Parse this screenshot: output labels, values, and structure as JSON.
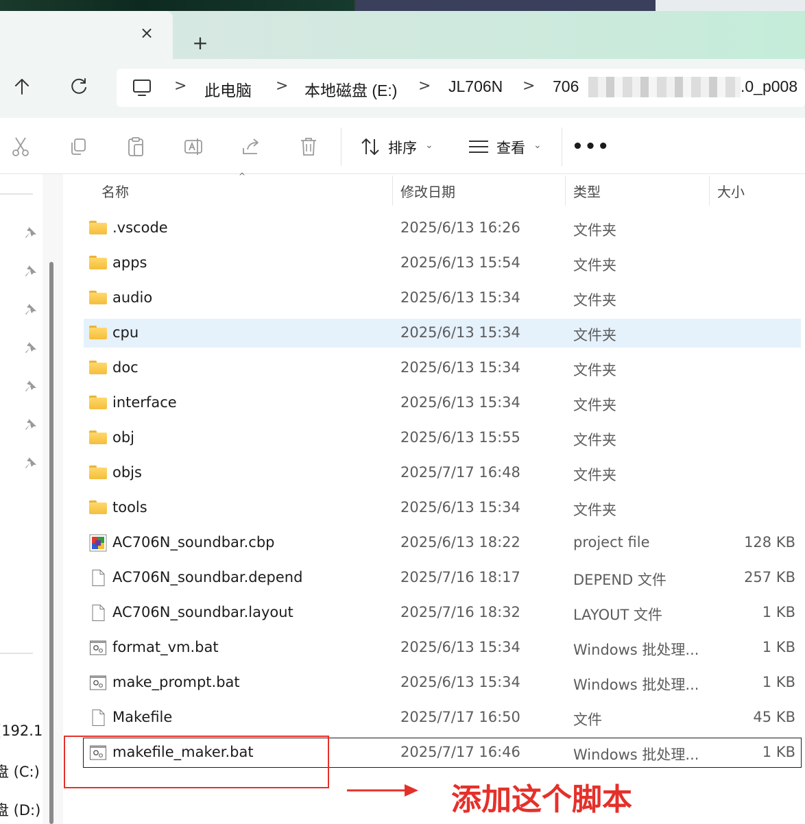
{
  "tabs": {
    "close_glyph": "×",
    "new_tab_glyph": "+"
  },
  "address": {
    "crumbs": [
      "此电脑",
      "本地磁盘 (E:)",
      "JL706N",
      "706 "
    ],
    "crumb_tail": ".0_p008",
    "separator": ">"
  },
  "toolbar": {
    "sort_label": "排序",
    "view_label": "查看",
    "more_label": "•••"
  },
  "nav": {
    "drives": [
      "(192.1",
      "盘 (C:)",
      "盘 (D:)"
    ]
  },
  "columns": {
    "name": "名称",
    "date": "修改日期",
    "type": "类型",
    "size": "大小"
  },
  "files": [
    {
      "name": ".vscode",
      "date": "2025/6/13 16:26",
      "type": "文件夹",
      "size": "",
      "kind": "folder"
    },
    {
      "name": "apps",
      "date": "2025/6/13 15:54",
      "type": "文件夹",
      "size": "",
      "kind": "folder"
    },
    {
      "name": "audio",
      "date": "2025/6/13 15:34",
      "type": "文件夹",
      "size": "",
      "kind": "folder"
    },
    {
      "name": "cpu",
      "date": "2025/6/13 15:34",
      "type": "文件夹",
      "size": "",
      "kind": "folder"
    },
    {
      "name": "doc",
      "date": "2025/6/13 15:34",
      "type": "文件夹",
      "size": "",
      "kind": "folder"
    },
    {
      "name": "interface",
      "date": "2025/6/13 15:34",
      "type": "文件夹",
      "size": "",
      "kind": "folder"
    },
    {
      "name": "obj",
      "date": "2025/6/13 15:55",
      "type": "文件夹",
      "size": "",
      "kind": "folder"
    },
    {
      "name": "objs",
      "date": "2025/7/17 16:48",
      "type": "文件夹",
      "size": "",
      "kind": "folder"
    },
    {
      "name": "tools",
      "date": "2025/6/13 15:34",
      "type": "文件夹",
      "size": "",
      "kind": "folder"
    },
    {
      "name": "AC706N_soundbar.cbp",
      "date": "2025/6/13 18:22",
      "type": "project file",
      "size": "128 KB",
      "kind": "cbp"
    },
    {
      "name": "AC706N_soundbar.depend",
      "date": "2025/7/16 18:17",
      "type": "DEPEND 文件",
      "size": "257 KB",
      "kind": "file"
    },
    {
      "name": "AC706N_soundbar.layout",
      "date": "2025/7/16 18:32",
      "type": "LAYOUT 文件",
      "size": "1 KB",
      "kind": "file"
    },
    {
      "name": "format_vm.bat",
      "date": "2025/6/13 15:34",
      "type": "Windows 批处理...",
      "size": "1 KB",
      "kind": "bat"
    },
    {
      "name": "make_prompt.bat",
      "date": "2025/6/13 15:34",
      "type": "Windows 批处理...",
      "size": "1 KB",
      "kind": "bat"
    },
    {
      "name": "Makefile",
      "date": "2025/7/17 16:50",
      "type": "文件",
      "size": "45 KB",
      "kind": "file"
    },
    {
      "name": "makefile_maker.bat",
      "date": "2025/7/17 16:46",
      "type": "Windows 批处理...",
      "size": "1 KB",
      "kind": "bat"
    }
  ],
  "selected_index": 3,
  "focused_index": 15,
  "annotation": {
    "text": "添加这个脚本",
    "color": "#e5302a"
  }
}
